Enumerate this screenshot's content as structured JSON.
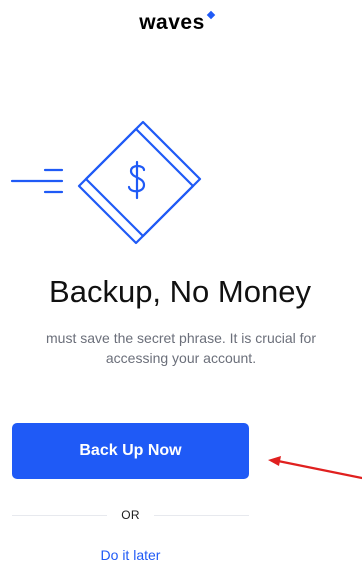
{
  "header": {
    "logo_text": "waves",
    "brand_color": "#1f5af6"
  },
  "illustration": {
    "icon": "dollar-diamond-icon",
    "accent": "#1f5af6"
  },
  "content": {
    "title": "Backup, No Money",
    "description_line1": "must save the secret phrase. It is crucial for",
    "description_line2": "accessing your account."
  },
  "actions": {
    "primary_label": "Back Up Now",
    "divider_label": "OR",
    "secondary_label": "Do it later"
  },
  "annotation": {
    "icon": "red-arrow-icon",
    "color": "#e0201f"
  }
}
